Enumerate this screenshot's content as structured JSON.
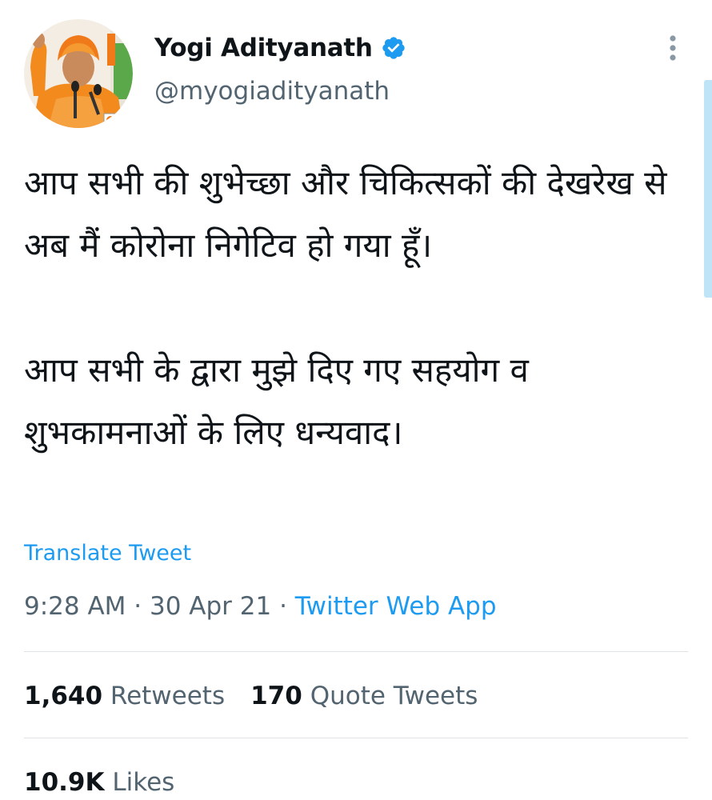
{
  "author": {
    "display_name": "Yogi Adityanath",
    "handle": "@myogiadityanath",
    "verified": true
  },
  "tweet": {
    "paragraphs": [
      "आप सभी की शुभेच्छा और चिकित्सकों की देखरेख से अब मैं कोरोना निगेटिव हो गया हूँ।",
      "आप सभी के द्वारा मुझे दिए गए सहयोग व शुभकामनाओं के लिए धन्यवाद।"
    ],
    "translate_label": "Translate Tweet",
    "time": "9:28 AM",
    "separator": " · ",
    "date": "30 Apr 21",
    "source": "Twitter Web App"
  },
  "stats": {
    "retweets_count": "1,640",
    "retweets_label": "Retweets",
    "quotes_count": "170",
    "quotes_label": "Quote Tweets",
    "likes_count": "10.9K",
    "likes_label": "Likes"
  },
  "icons": {
    "verified": "verified-badge-icon",
    "more": "more-vertical-icon"
  },
  "colors": {
    "accent": "#1d9bf0",
    "secondary_text": "#536471",
    "primary_text": "#0f1419",
    "divider": "#dfe3e6"
  }
}
